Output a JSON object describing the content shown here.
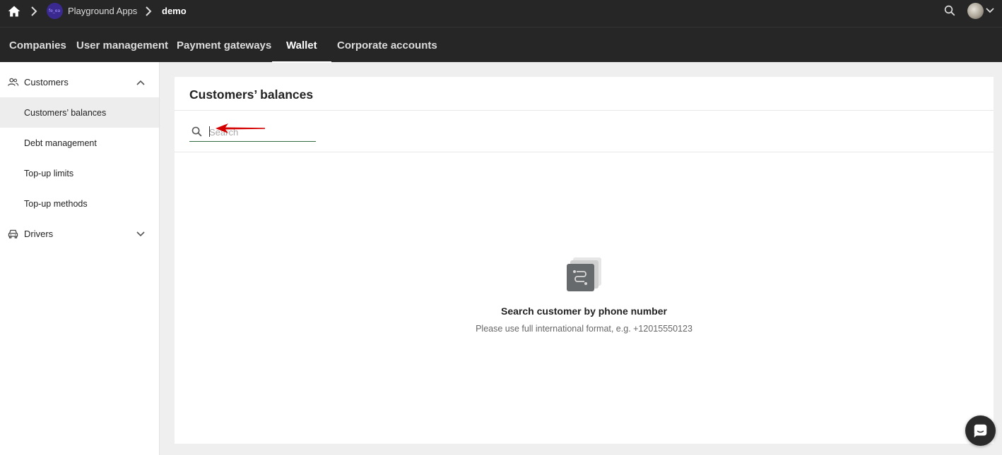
{
  "breadcrumb": {
    "home_icon": "home-icon",
    "app_name": "Playground Apps",
    "app_logo_text": "fe_ea",
    "project": "demo"
  },
  "header": {
    "search_icon": "search-icon",
    "avatar": "user-avatar",
    "avatar_menu_icon": "chevron-down-icon"
  },
  "nav": {
    "tabs": [
      {
        "label": "Companies",
        "active": false
      },
      {
        "label": "User management",
        "active": false
      },
      {
        "label": "Payment gateways",
        "active": false
      },
      {
        "label": "Wallet",
        "active": true
      },
      {
        "label": "Corporate accounts",
        "active": false
      }
    ]
  },
  "sidebar": {
    "groups": [
      {
        "label": "Customers",
        "icon": "people-icon",
        "expanded": true,
        "items": [
          {
            "label": "Customers’ balances",
            "active": true
          },
          {
            "label": "Debt management",
            "active": false
          },
          {
            "label": "Top-up limits",
            "active": false
          },
          {
            "label": "Top-up methods",
            "active": false
          }
        ]
      },
      {
        "label": "Drivers",
        "icon": "car-icon",
        "expanded": false,
        "items": []
      }
    ]
  },
  "main": {
    "title": "Customers’ balances",
    "search": {
      "placeholder": "Search",
      "value": ""
    },
    "empty_state": {
      "icon": "route-icon",
      "title": "Search customer by phone number",
      "subtitle": "Please use full international format, e.g. +12015550123"
    }
  },
  "colors": {
    "topbar": "#262626",
    "search_underline": "#2f6b3f",
    "annotation_arrow": "#d40000"
  },
  "chat_widget": {
    "icon": "chat-icon"
  }
}
